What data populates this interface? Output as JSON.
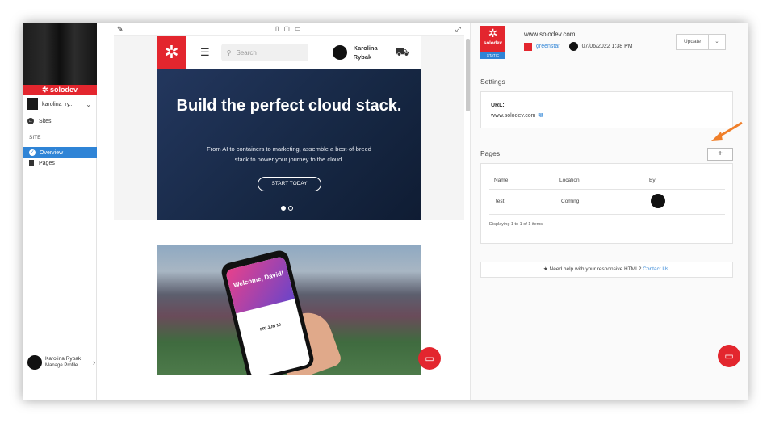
{
  "sidebar": {
    "brand": "solodev",
    "user_name": "karolina_ry...",
    "sites_label": "Sites",
    "section_label": "SITE",
    "overview_label": "Overview",
    "pages_label": "Pages",
    "profile_name": "Karolina Rybak",
    "profile_sub": "Manage Profile"
  },
  "preview": {
    "toolbar": {
      "edit_icon": "pencil-icon",
      "devices": [
        "mobile-icon",
        "tablet-icon",
        "desktop-icon"
      ],
      "expand_icon": "expand-icon"
    },
    "site": {
      "search_placeholder": "Search",
      "user_first": "Karolina",
      "user_last": "Rybak",
      "hero_title": "Build the perfect cloud stack.",
      "hero_subtitle": "From AI to containers to marketing, assemble a best-of-breed stack to power your journey to the cloud.",
      "hero_button": "START TODAY",
      "phone_welcome": "Welcome, David!",
      "phone_date": "FRI JUN 10"
    }
  },
  "right": {
    "logo_name": "solodev",
    "logo_static": "STATIC",
    "domain": "www.solodev.com",
    "owner": "greenstar",
    "timestamp": "07/06/2022 1:38 PM",
    "update_label": "Update",
    "settings_heading": "Settings",
    "url_label": "URL:",
    "url_value": "www.solodev.com",
    "pages_heading": "Pages",
    "add_label": "+",
    "table": {
      "headers": [
        "Name",
        "Location",
        "By"
      ],
      "rows": [
        {
          "name": "test",
          "location": "Coming"
        }
      ],
      "footer": "Displaying 1 to 1 of 1 items"
    },
    "help_text": "Need help with your responsive HTML?",
    "help_link": "Contact Us."
  },
  "colors": {
    "brand_red": "#e3262e",
    "accent_blue": "#2f84d6",
    "annotation_arrow": "#f07f2a"
  }
}
